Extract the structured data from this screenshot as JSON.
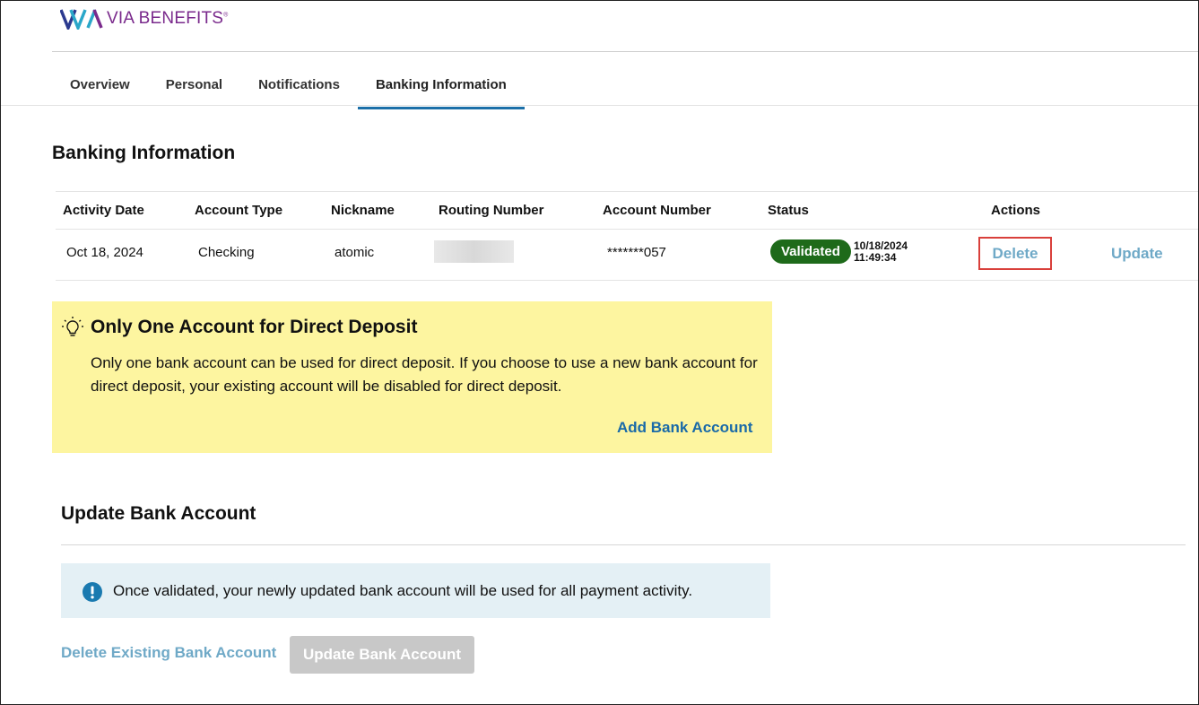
{
  "brand": {
    "name": "VIA BENEFITS",
    "mark": "®",
    "logo_colors": [
      "#2b3a8f",
      "#2aa7c9",
      "#7a2a8c"
    ]
  },
  "tabs": [
    {
      "label": "Overview",
      "active": false
    },
    {
      "label": "Personal",
      "active": false
    },
    {
      "label": "Notifications",
      "active": false
    },
    {
      "label": "Banking Information",
      "active": true
    }
  ],
  "banking": {
    "title": "Banking Information",
    "columns": [
      "Activity Date",
      "Account Type",
      "Nickname",
      "Routing Number",
      "Account Number",
      "Status",
      "Actions"
    ],
    "rows": [
      {
        "activity_date": "Oct 18, 2024",
        "account_type": "Checking",
        "nickname": "atomic",
        "routing_number": "",
        "account_number": "*******057",
        "status": "Validated",
        "status_date": "10/18/2024",
        "status_time": "11:49:34",
        "action_delete": "Delete",
        "action_update": "Update"
      }
    ]
  },
  "notice": {
    "icon": "lightbulb-icon",
    "title": "Only One Account for Direct Deposit",
    "body": "Only one bank account can be used for direct deposit. If you choose to use a new bank account for direct deposit, your existing account will be disabled for direct deposit.",
    "link": "Add Bank Account"
  },
  "update_section": {
    "title": "Update Bank Account",
    "info_icon": "exclamation-circle-icon",
    "info_text": "Once validated, your newly updated bank account will be used for all payment activity.",
    "delete_link": "Delete Existing Bank Account",
    "update_button": "Update Bank Account"
  },
  "colors": {
    "accent": "#1b6fa8",
    "link_muted": "#6fa9c7",
    "validated": "#1e6a1a",
    "notice_bg": "#fdf5a0",
    "info_bg": "#e4f0f5",
    "highlight": "#d9403b"
  }
}
